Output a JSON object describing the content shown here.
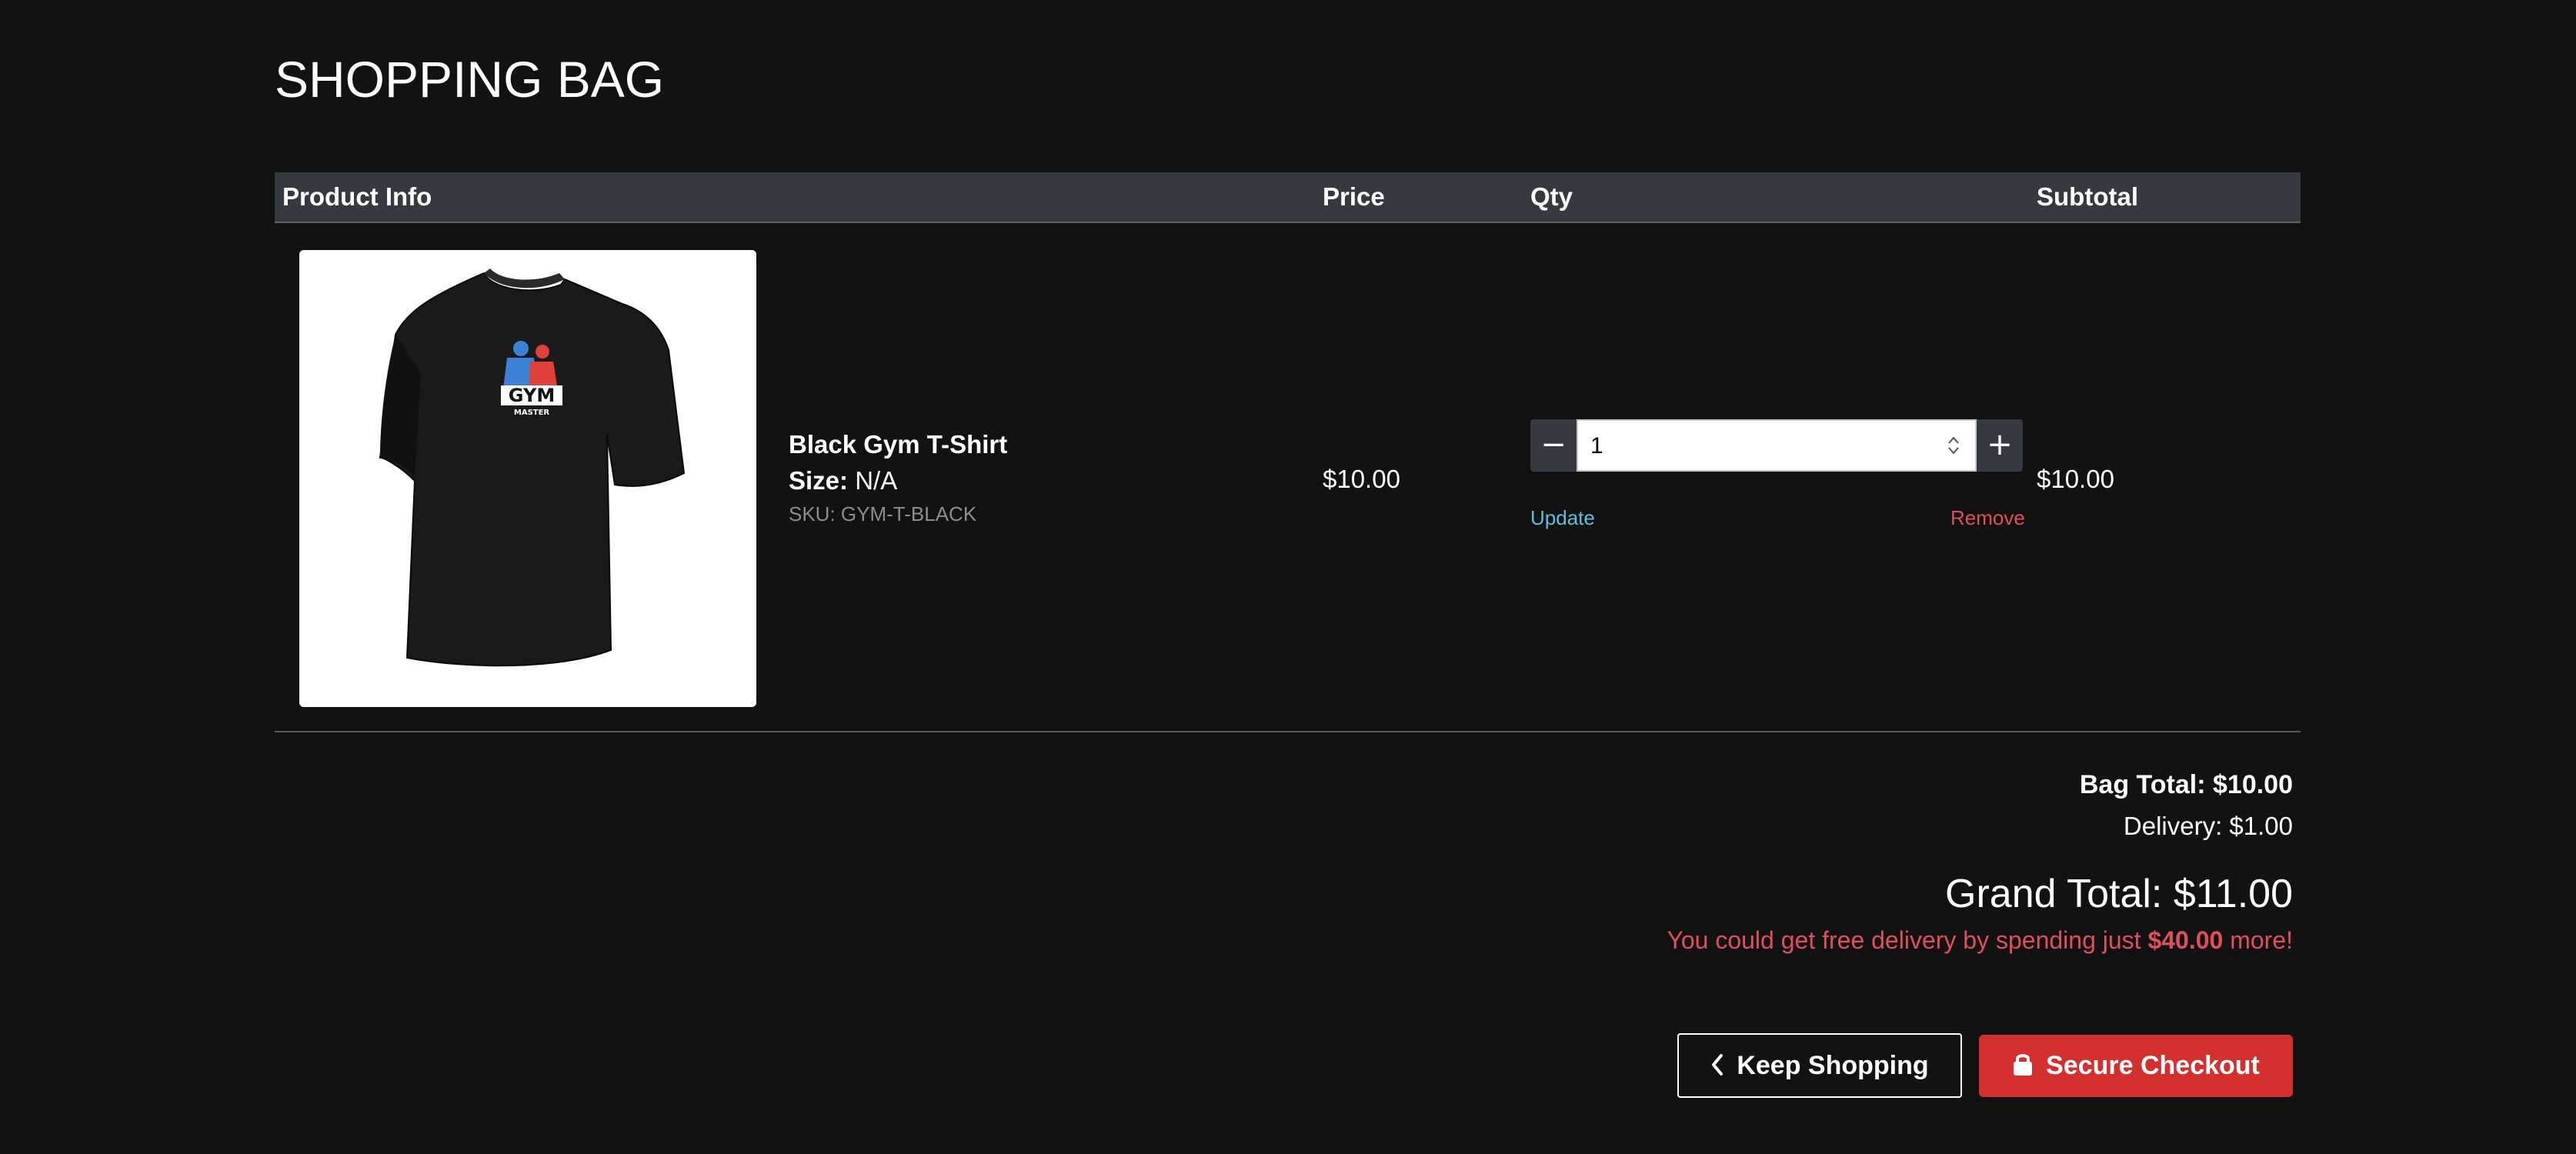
{
  "page": {
    "title": "SHOPPING BAG"
  },
  "table": {
    "headers": {
      "product_info": "Product Info",
      "price": "Price",
      "qty": "Qty",
      "subtotal": "Subtotal"
    },
    "rows": [
      {
        "name": "Black Gym T-Shirt",
        "size_label": "Size:",
        "size_value": "N/A",
        "sku": "SKU: GYM-T-BLACK",
        "price": "$10.00",
        "qty": "1",
        "subtotal": "$10.00",
        "update_label": "Update",
        "remove_label": "Remove",
        "image_icon": "black-tshirt-gym-master-logo"
      }
    ]
  },
  "totals": {
    "bag_total": "Bag Total: $10.00",
    "delivery": "Delivery: $1.00",
    "grand_total": "Grand Total: $11.00",
    "free_delivery_prefix": "You could get free delivery by spending just ",
    "free_delivery_amount": "$40.00",
    "free_delivery_suffix": " more!"
  },
  "actions": {
    "keep_shopping": "Keep Shopping",
    "secure_checkout": "Secure Checkout"
  },
  "colors": {
    "background": "#121213",
    "header_bar": "#343a40",
    "accent_red": "#d32f2f",
    "link_blue": "#5bc0de",
    "remove_red": "#e0505a"
  }
}
